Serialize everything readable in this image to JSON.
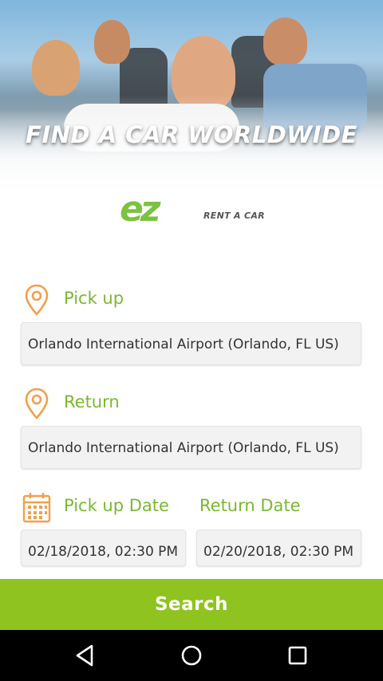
{
  "hero": {
    "title": "FIND A CAR WORLDWIDE"
  },
  "logo": {
    "mark": "ez",
    "subtitle": "RENT A CAR"
  },
  "pickup": {
    "label": "Pick up",
    "value": "Orlando International Airport (Orlando, FL US)"
  },
  "return": {
    "label": "Return",
    "value": "Orlando International Airport (Orlando, FL US)"
  },
  "dates": {
    "pickup_label": "Pick up Date",
    "return_label": "Return Date",
    "pickup_value": "02/18/2018, 02:30 PM",
    "return_value": "02/20/2018, 02:30 PM"
  },
  "search": {
    "label": "Search"
  },
  "navbar": {
    "icons": [
      "back-icon",
      "home-icon",
      "recents-icon"
    ]
  },
  "colors": {
    "accent_green": "#8fc31f",
    "label_green": "#7ab82f",
    "icon_orange": "#f0a04b"
  }
}
